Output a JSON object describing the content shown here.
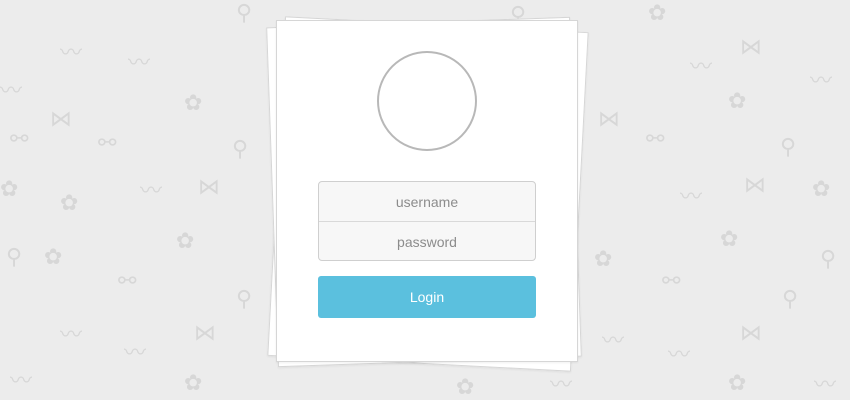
{
  "login_form": {
    "username_placeholder": "username",
    "password_placeholder": "password",
    "submit_label": "Login"
  },
  "theme": {
    "background": "#ececec",
    "card": "#ffffff",
    "accent": "#5bc0de",
    "pattern": "#d7d7d7"
  },
  "background_pattern": {
    "icons": [
      "mustache-icon",
      "bow-tie-icon",
      "leaf-icon",
      "bicycle-icon",
      "pipe-icon"
    ]
  }
}
